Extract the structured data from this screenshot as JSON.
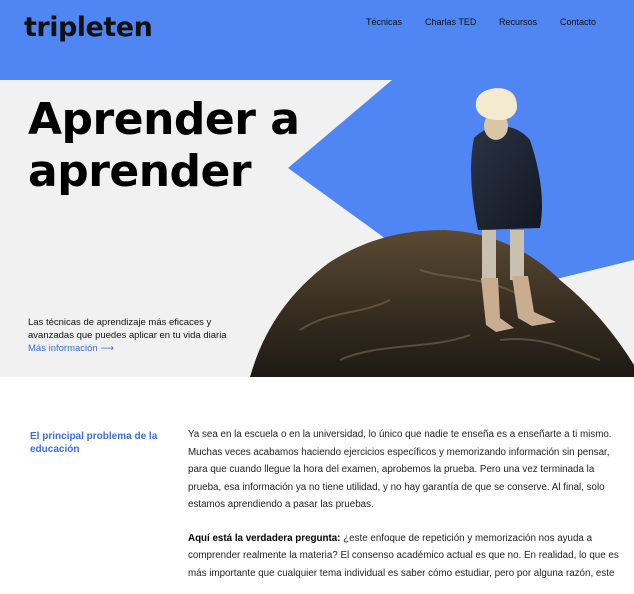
{
  "header": {
    "logo": "tripleten",
    "nav": [
      "Técnicas",
      "Charlas TED",
      "Recursos",
      "Contacto"
    ]
  },
  "hero": {
    "title_lines": [
      "Aprender a",
      "aprender"
    ],
    "desc_lines": [
      "Las técnicas de aprendizaje más eficaces y",
      "avanzadas que puedes aplicar en tu vida diaria"
    ],
    "link": "Más información"
  },
  "section": {
    "heading_lines": [
      "El principal problema de la",
      "educación"
    ],
    "para1_lines": [
      "Ya sea en la escuela o en la universidad, lo único que nadie te enseña es a enseñarte a ti mismo.",
      "Muchas veces acabamos haciendo ejercicios específicos y memorizando información sin pensar,",
      "para que cuando llegue la hora del examen, aprobemos la prueba. Pero una vez terminada la",
      "prueba, esa información ya no tiene utilidad, y no hay garantía de que se conserve. Al final, solo",
      "estamos aprendiendo a pasar las pruebas."
    ],
    "para2_bold": "Aquí está la verdadera pregunta:",
    "para2_first_rest": " ¿este enfoque de repetición y memorización nos ayuda a",
    "para2_lines": [
      "comprender realmente la materia? El consenso académico actual es que no. En realidad, lo que es",
      "más importante que cualquier tema individual es saber cómo estudiar, pero por alguna razón, este"
    ]
  },
  "colors": {
    "header_bg": "#4f86f3",
    "accent": "#3b6fe0",
    "hero_bg": "#f1f1f2"
  }
}
